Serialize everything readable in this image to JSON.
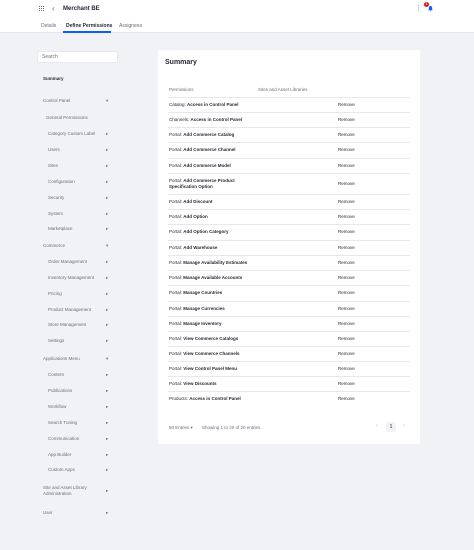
{
  "header": {
    "title": "Merchant BE",
    "notification_count": "1"
  },
  "tabs": [
    {
      "label": "Details"
    },
    {
      "label": "Define Permissions"
    },
    {
      "label": "Assignees"
    }
  ],
  "search": {
    "placeholder": "Search"
  },
  "sidebar": {
    "summary": "Summary",
    "control_panel": "Control Panel",
    "general_permissions": "General Permissions",
    "category_custom_label": "Category Custom Label",
    "users": "Users",
    "sites": "Sites",
    "configuration": "Configuration",
    "security": "Security",
    "system": "System",
    "marketplace": "Marketplace",
    "commerce": "Commerce",
    "order_management": "Order Management",
    "inventory_management": "Inventory Management",
    "pricing": "Pricing",
    "product_management": "Product Management",
    "store_management": "Store Management",
    "settings": "Settings",
    "applications_menu": "Applications Menu",
    "content": "Content",
    "publications": "Publications",
    "workflow": "Workflow",
    "search_tuning": "Search Tuning",
    "communication": "Communication",
    "app_builder": "App Builder",
    "custom_apps": "Custom Apps",
    "site_asset_admin_1": "Site and Asset Library",
    "site_asset_admin_2": "Administration",
    "user": "User"
  },
  "summary": {
    "title": "Summary",
    "col_permissions": "Permissions",
    "col_sites": "Sites and Asset Libraries",
    "remove_label": "Remove",
    "rows": [
      {
        "prefix": "Catalog:",
        "name": "Access in Control Panel"
      },
      {
        "prefix": "Channels:",
        "name": "Access in Control Panel"
      },
      {
        "prefix": "Portal:",
        "name": "Add Commerce Catalog"
      },
      {
        "prefix": "Portal:",
        "name": "Add Commerce Channel"
      },
      {
        "prefix": "Portal:",
        "name": "Add Commerce Model"
      },
      {
        "prefix": "Portal:",
        "name": "Add Commerce Product Specification Option"
      },
      {
        "prefix": "Portal:",
        "name": "Add Discount"
      },
      {
        "prefix": "Portal:",
        "name": "Add Option"
      },
      {
        "prefix": "Portal:",
        "name": "Add Option Category"
      },
      {
        "prefix": "Portal:",
        "name": "Add Warehouse"
      },
      {
        "prefix": "Portal:",
        "name": "Manage Availability Estimates"
      },
      {
        "prefix": "Portal:",
        "name": "Manage Available Accounts"
      },
      {
        "prefix": "Portal:",
        "name": "Manage Countries"
      },
      {
        "prefix": "Portal:",
        "name": "Manage Currencies"
      },
      {
        "prefix": "Portal:",
        "name": "Manage Inventory"
      },
      {
        "prefix": "Portal:",
        "name": "View Commerce Catalogs"
      },
      {
        "prefix": "Portal:",
        "name": "View Commerce Channels"
      },
      {
        "prefix": "Portal:",
        "name": "View Control Panel Menu"
      },
      {
        "prefix": "Portal:",
        "name": "View Discounts"
      },
      {
        "prefix": "Products:",
        "name": "Access in Control Panel"
      }
    ],
    "entries_label": "50 Entries",
    "showing_label": "Showing 1 to 20 of 20 entries.",
    "current_page": "1"
  }
}
